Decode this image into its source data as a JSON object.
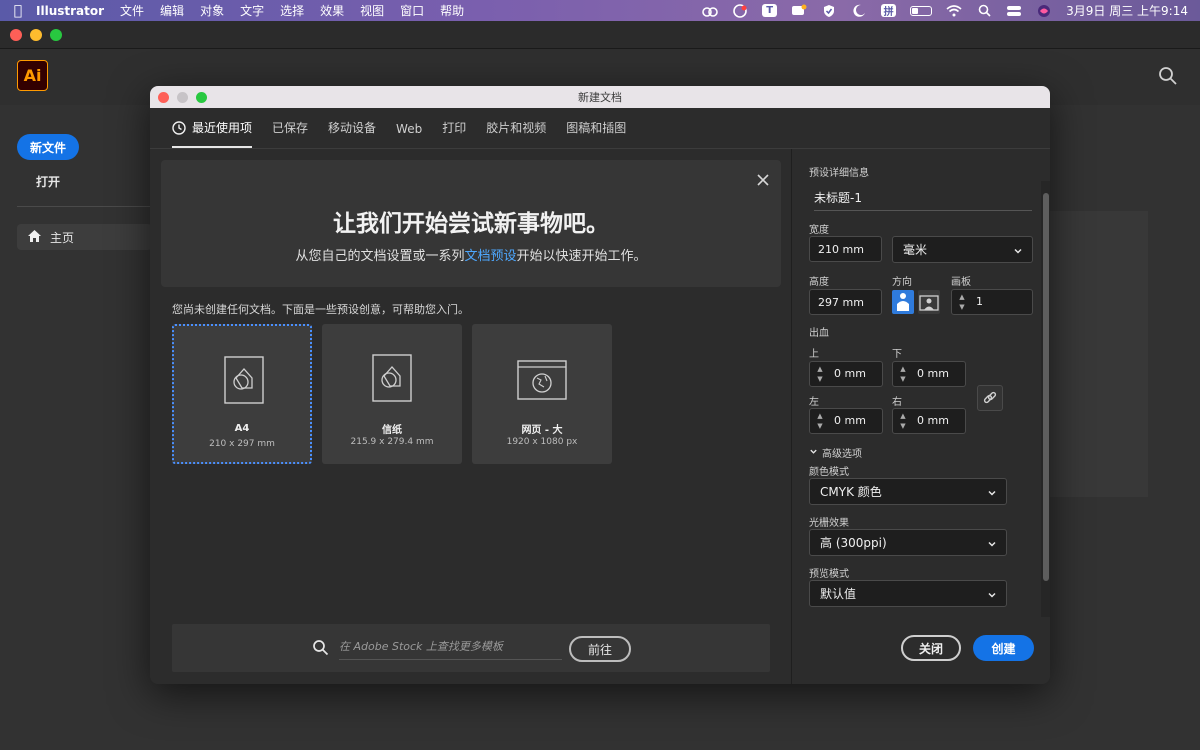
{
  "menubar": {
    "app_name": "Illustrator",
    "items": [
      "文件",
      "编辑",
      "对象",
      "文字",
      "选择",
      "效果",
      "视图",
      "窗口",
      "帮助"
    ],
    "clock": "3月9日 周三 上午9:14",
    "t_badge": "T",
    "grid_glyph": "拼"
  },
  "app": {
    "logo": "Ai",
    "new_file_label": "新文件",
    "open_label": "打开",
    "home_label": "主页"
  },
  "dialog": {
    "title": "新建文档",
    "tabs": [
      "最近使用项",
      "已保存",
      "移动设备",
      "Web",
      "打印",
      "胶片和视频",
      "图稿和插图"
    ],
    "hero_title": "让我们开始尝试新事物吧。",
    "hero_sub_before": "从您自己的文档设置或一系列",
    "hero_sub_link": "文档预设",
    "hero_sub_after": "开始以快速开始工作。",
    "notice": "您尚未创建任何文档。下面是一些预设创意，可帮助您入门。",
    "presets": [
      {
        "name": "A4",
        "size": "210 x 297 mm"
      },
      {
        "name": "信纸",
        "size": "215.9 x 279.4 mm"
      },
      {
        "name": "网页 - 大",
        "size": "1920 x 1080 px"
      }
    ],
    "stock_placeholder": "在 Adobe Stock 上查找更多模板",
    "stock_go": "前往"
  },
  "details": {
    "header": "预设详细信息",
    "doc_name": "未标题-1",
    "width_label": "宽度",
    "width_value": "210 mm",
    "unit_value": "毫米",
    "height_label": "高度",
    "height_value": "297 mm",
    "orientation_label": "方向",
    "artboards_label": "画板",
    "artboards_value": "1",
    "bleed_label": "出血",
    "top_label": "上",
    "bottom_label": "下",
    "left_label": "左",
    "right_label": "右",
    "bleed_top": "0 mm",
    "bleed_bottom": "0 mm",
    "bleed_left": "0 mm",
    "bleed_right": "0 mm",
    "advanced_label": "高级选项",
    "color_mode_label": "颜色模式",
    "color_mode_value": "CMYK 颜色",
    "raster_label": "光栅效果",
    "raster_value": "高 (300ppi)",
    "preview_label": "预览模式",
    "preview_value": "默认值",
    "close_button": "关闭",
    "create_button": "创建"
  },
  "colors": {
    "accent": "#1473e6",
    "link": "#4ea8ff",
    "ai_orange": "#ff9a00"
  }
}
